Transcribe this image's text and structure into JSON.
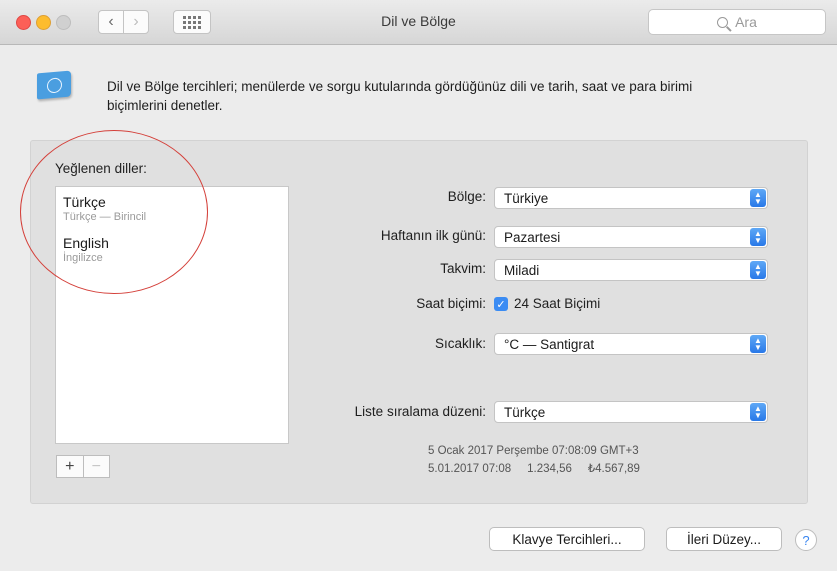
{
  "window": {
    "title": "Dil ve Bölge",
    "search_placeholder": "Ara"
  },
  "description": "Dil ve Bölge tercihleri; menülerde ve sorgu kutularında gördüğünüz dili ve tarih, saat ve para birimi biçimlerini denetler.",
  "languages": {
    "header": "Yeğlenen diller:",
    "items": [
      {
        "name": "Türkçe",
        "subtitle": "Türkçe — Birincil"
      },
      {
        "name": "English",
        "subtitle": "İngilizce"
      }
    ],
    "add_label": "+",
    "remove_label": "−"
  },
  "settings": {
    "region_label": "Bölge:",
    "region_value": "Türkiye",
    "first_day_label": "Haftanın ilk günü:",
    "first_day_value": "Pazartesi",
    "calendar_label": "Takvim:",
    "calendar_value": "Miladi",
    "time_format_label": "Saat biçimi:",
    "time_format_checkbox": "24 Saat Biçimi",
    "temperature_label": "Sıcaklık:",
    "temperature_value": "°C — Santigrat",
    "sort_order_label": "Liste sıralama düzeni:",
    "sort_order_value": "Türkçe"
  },
  "samples": {
    "line1": "5 Ocak 2017 Perşembe 07:08:09 GMT+3",
    "line2": "5.01.2017 07:08     1.234,56     ₺4.567,89"
  },
  "buttons": {
    "keyboard_prefs": "Klavye Tercihleri...",
    "advanced": "İleri Düzey...",
    "help": "?"
  },
  "colors": {
    "accent": "#2f80ed",
    "annotation_circle": "#d4403a"
  }
}
